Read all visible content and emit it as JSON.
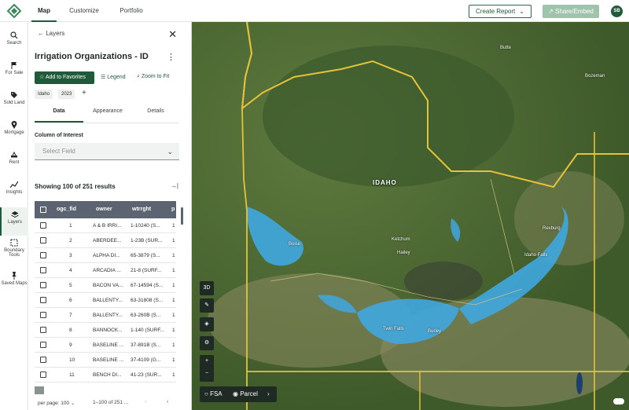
{
  "topbar": {
    "tabs": [
      "Map",
      "Customize",
      "Portfolio"
    ],
    "create_report": "Create Report",
    "share_embed": "Share/Embed",
    "avatar": "SB"
  },
  "rail": [
    {
      "label": "Search",
      "icon": "search-icon"
    },
    {
      "label": "For Sale",
      "icon": "flag-icon"
    },
    {
      "label": "Sold Land",
      "icon": "tag-icon"
    },
    {
      "label": "Mortgage",
      "icon": "pin-icon"
    },
    {
      "label": "Rent",
      "icon": "handshake-icon"
    },
    {
      "label": "Insights",
      "icon": "chart-icon"
    },
    {
      "label": "Layers",
      "icon": "layers-icon"
    },
    {
      "label": "Boundary Tools",
      "icon": "boundary-icon"
    },
    {
      "label": "Saved Maps",
      "icon": "pushpin-icon"
    }
  ],
  "panel": {
    "back_label": "Layers",
    "title": "Irrigation Organizations - ID",
    "add_favorites": "Add to Favorites",
    "legend": "Legend",
    "zoom_to_fit": "Zoom to Fit",
    "chips": [
      "Idaho",
      "2023"
    ],
    "subtabs": [
      "Data",
      "Appearance",
      "Details"
    ],
    "column_of_interest": "Column of Interest",
    "select_placeholder": "Select Field",
    "showing": "Showing 100 of 251 results",
    "columns": [
      "ogc_fid",
      "owner",
      "wtrrght",
      "p"
    ],
    "rows": [
      {
        "id": "1",
        "owner": "A & B IRRI...",
        "wtrrght": "1-10240 (S...",
        "p": "1"
      },
      {
        "id": "2",
        "owner": "ABERDEE...",
        "wtrrght": "1-23B (SUR...",
        "p": "1"
      },
      {
        "id": "3",
        "owner": "ALPHA DI...",
        "wtrrght": "65-3879 (S...",
        "p": "1"
      },
      {
        "id": "4",
        "owner": "ARCADIA ...",
        "wtrrght": "21-8 (SURF...",
        "p": "1"
      },
      {
        "id": "5",
        "owner": "BACON VA...",
        "wtrrght": "67-14594 (S...",
        "p": "1"
      },
      {
        "id": "6",
        "owner": "BALLENTY...",
        "wtrrght": "63-31808 (S...",
        "p": "1"
      },
      {
        "id": "7",
        "owner": "BALLENTY...",
        "wtrrght": "63-260B (S...",
        "p": "1"
      },
      {
        "id": "8",
        "owner": "BANNOCK...",
        "wtrrght": "1-140 (SURF...",
        "p": "1"
      },
      {
        "id": "9",
        "owner": "BASELINE ...",
        "wtrrght": "37-891B (S...",
        "p": "1"
      },
      {
        "id": "10",
        "owner": "BASELINE ...",
        "wtrrght": "37-4109 (G...",
        "p": "1"
      },
      {
        "id": "11",
        "owner": "BENCH DI...",
        "wtrrght": "41-23 (SUR...",
        "p": "1"
      }
    ],
    "per_page": "per page: 100",
    "range": "1–100 of 251 ..."
  },
  "map": {
    "state_label": "IDAHO",
    "cities": [
      "Butte",
      "Bozeman",
      "Boise",
      "Ketchum",
      "Hailey",
      "Twin Falls",
      "Burley",
      "Rexburg",
      "Idaho Falls"
    ],
    "controls": [
      "3D"
    ],
    "fsa_label": "FSA",
    "parcel_label": "Parcel",
    "colors": {
      "irrigation": "#3fa7e0",
      "border": "#e6c23a",
      "terrain": "#4f6b34"
    }
  }
}
